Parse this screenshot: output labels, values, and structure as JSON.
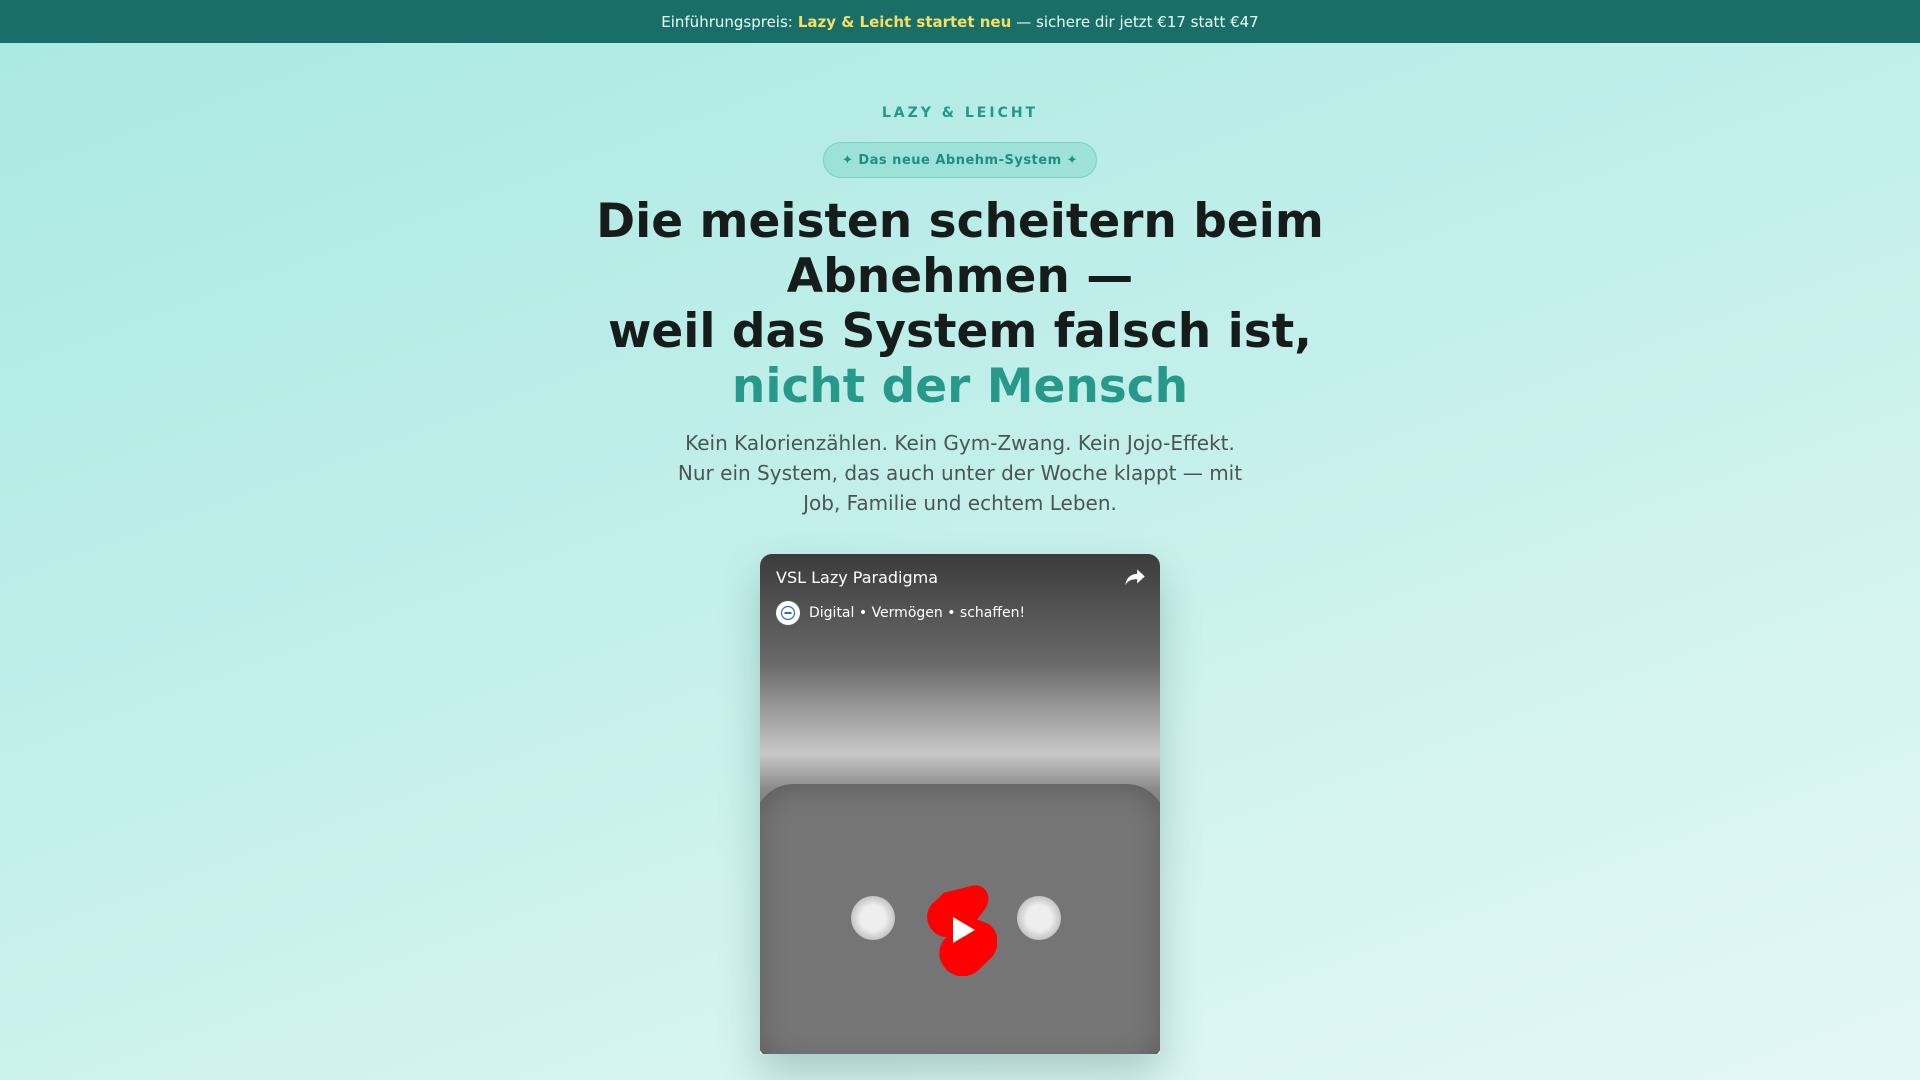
{
  "promo": {
    "prefix": "Einführungspreis:",
    "highlight": "Lazy & Leicht startet neu",
    "suffix": "— sichere dir jetzt €17 statt €47"
  },
  "hero": {
    "kicker": "LAZY & LEICHT",
    "badge": "✦ Das neue Abnehm-System ✦",
    "headline": {
      "line1": "Die meisten scheitern beim Abnehmen —",
      "line2": "weil das System falsch ist,",
      "accent": "nicht der Mensch"
    },
    "subline": "Kein Kalorienzählen. Kein Gym-Zwang. Kein Jojo-Effekt. Nur ein System, das auch unter der Woche klappt — mit Job, Familie und echtem Leben."
  },
  "video": {
    "title": "VSL Lazy Paradigma",
    "channel": "Digital • Vermögen • schaffen!",
    "share_icon": "share-arrow-icon",
    "play_icon": "youtube-shorts-play-icon",
    "brand_color": "#ff0000"
  },
  "colors": {
    "promo_bg": "#1a6e68",
    "promo_highlight": "#f7df62",
    "accent": "#26998b",
    "text": "#161c1b"
  }
}
